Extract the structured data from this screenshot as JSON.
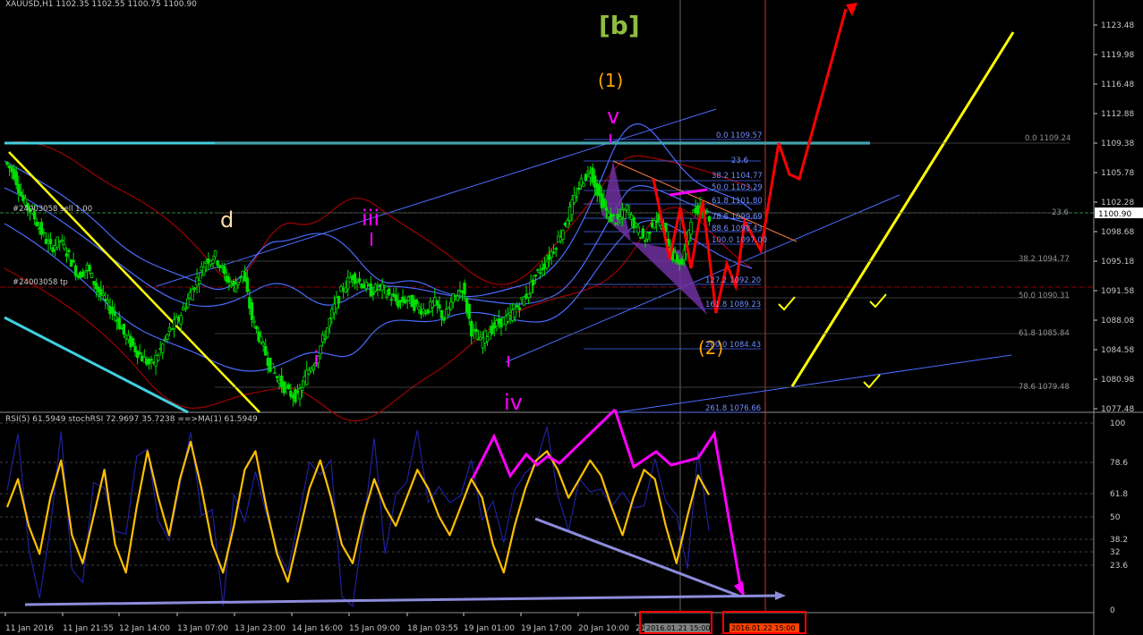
{
  "header": {
    "symbol_line": "XAUUSD,H1  1102.35 1102.55 1100.75 1100.90",
    "rsi_line": "RSI(5) 61.5949  stochRSI 72.9697 35.7238  ==>MA(1) 61.5949"
  },
  "price_axis": {
    "ticks": [
      "1123.48",
      "1119.98",
      "1116.48",
      "1112.88",
      "1109.38",
      "1105.78",
      "1102.28",
      "1098.68",
      "1095.18",
      "1091.58",
      "1088.08",
      "1084.58",
      "1080.98",
      "1077.48"
    ],
    "current_price": "1100.90"
  },
  "rsi_axis": {
    "ticks": [
      "100",
      "78.6",
      "61.8",
      "50",
      "38.2",
      "32",
      "23.6",
      "0"
    ]
  },
  "time_axis": {
    "labels": [
      "11 Jan 2016",
      "11 Jan 21:55",
      "12 Jan 14:00",
      "13 Jan 07:00",
      "13 Jan 23:00",
      "14 Jan 16:00",
      "15 Jan 09:00",
      "18 Jan 03:55",
      "19 Jan 01:00",
      "19 Jan 17:00",
      "20 Jan 10:00",
      "21"
    ],
    "box_1": "2016.01.21 15:00",
    "box_2": "2016.01.22 15:00"
  },
  "wave_labels": {
    "b": "[b]",
    "one": "(1)",
    "two": "(2)",
    "v": "v",
    "iv": "iv",
    "iii": "iii",
    "i": "i",
    "d": "d"
  },
  "fib_left": {
    "f0": "0.0 1109.57",
    "f236": "23.6",
    "f382": "38.2 1104.77",
    "f50": "50.0 1103.29",
    "f618": "61.8 1101.80",
    "f786": "78.6 1099.69",
    "f886": "88.6 1098.43",
    "f100": "100.0 1097.00",
    "f1272": "127.2 1092.20",
    "f1618": "161.8 1089.23",
    "f200": "200.0 1084.43",
    "f2618": "261.8 1076.66"
  },
  "fib_right": {
    "f0": "0.0 1109.24",
    "f236": "23.6",
    "f382": "38.2 1094.77",
    "f50": "50.0 1090.31",
    "f618": "61.8 1085.84",
    "f786": "78.6 1079.48"
  },
  "order_labels": {
    "sell": "#24003058 sell 1.00",
    "tp": "#24003058 tp"
  },
  "colors": {
    "background": "#000000",
    "candles": "#00ff00",
    "bollinger_inner": "#4a6cff",
    "bollinger_outer": "#a00000",
    "resistance": "#40d0e0",
    "projection": "#ff0000",
    "trend_yellow": "#ffff00",
    "wave_magenta": "#ff00ff",
    "wave_orange": "#ffa500",
    "rsi_line": "#ffc000",
    "stoch_line": "#2020a0"
  },
  "chart_data": {
    "type": "line",
    "title": "XAUUSD,H1",
    "ylim": [
      1076.5,
      1125.5
    ],
    "price_path": [
      1108.0,
      1106.5,
      1103.0,
      1101.5,
      1099.0,
      1097.0,
      1098.0,
      1096.0,
      1093.5,
      1094.5,
      1092.0,
      1090.0,
      1088.5,
      1086.0,
      1084.5,
      1083.0,
      1082.0,
      1084.0,
      1086.5,
      1088.0,
      1090.5,
      1093.0,
      1095.5,
      1096.0,
      1093.5,
      1092.0,
      1094.0,
      1088.0,
      1085.0,
      1082.0,
      1080.0,
      1078.5,
      1078.0,
      1081.0,
      1083.0,
      1086.0,
      1089.5,
      1092.0,
      1093.5,
      1092.5,
      1091.5,
      1092.0,
      1091.0,
      1090.0,
      1090.5,
      1089.5,
      1089.0,
      1090.0,
      1088.0,
      1090.5,
      1092.0,
      1086.5,
      1085.0,
      1086.5,
      1087.5,
      1088.0,
      1089.5,
      1091.0,
      1093.5,
      1095.0,
      1097.0,
      1099.5,
      1102.5,
      1105.5,
      1107.0,
      1103.5,
      1101.0,
      1100.5,
      1102.0,
      1099.5,
      1098.0,
      1101.0,
      1099.5,
      1096.0,
      1095.0,
      1101.0,
      1102.5,
      1100.9
    ],
    "rsi_path": [
      55,
      70,
      45,
      30,
      60,
      80,
      40,
      25,
      50,
      75,
      35,
      20,
      55,
      85,
      60,
      40,
      70,
      90,
      65,
      35,
      20,
      45,
      75,
      85,
      55,
      30,
      15,
      40,
      65,
      80,
      60,
      35,
      25,
      50,
      70,
      55,
      45,
      60,
      75,
      65,
      50,
      40,
      55,
      70,
      60,
      35,
      20,
      45,
      65,
      80,
      85,
      75,
      60,
      70,
      80,
      72,
      55,
      40,
      60,
      75,
      70,
      45,
      25,
      50,
      72,
      61.6
    ]
  }
}
